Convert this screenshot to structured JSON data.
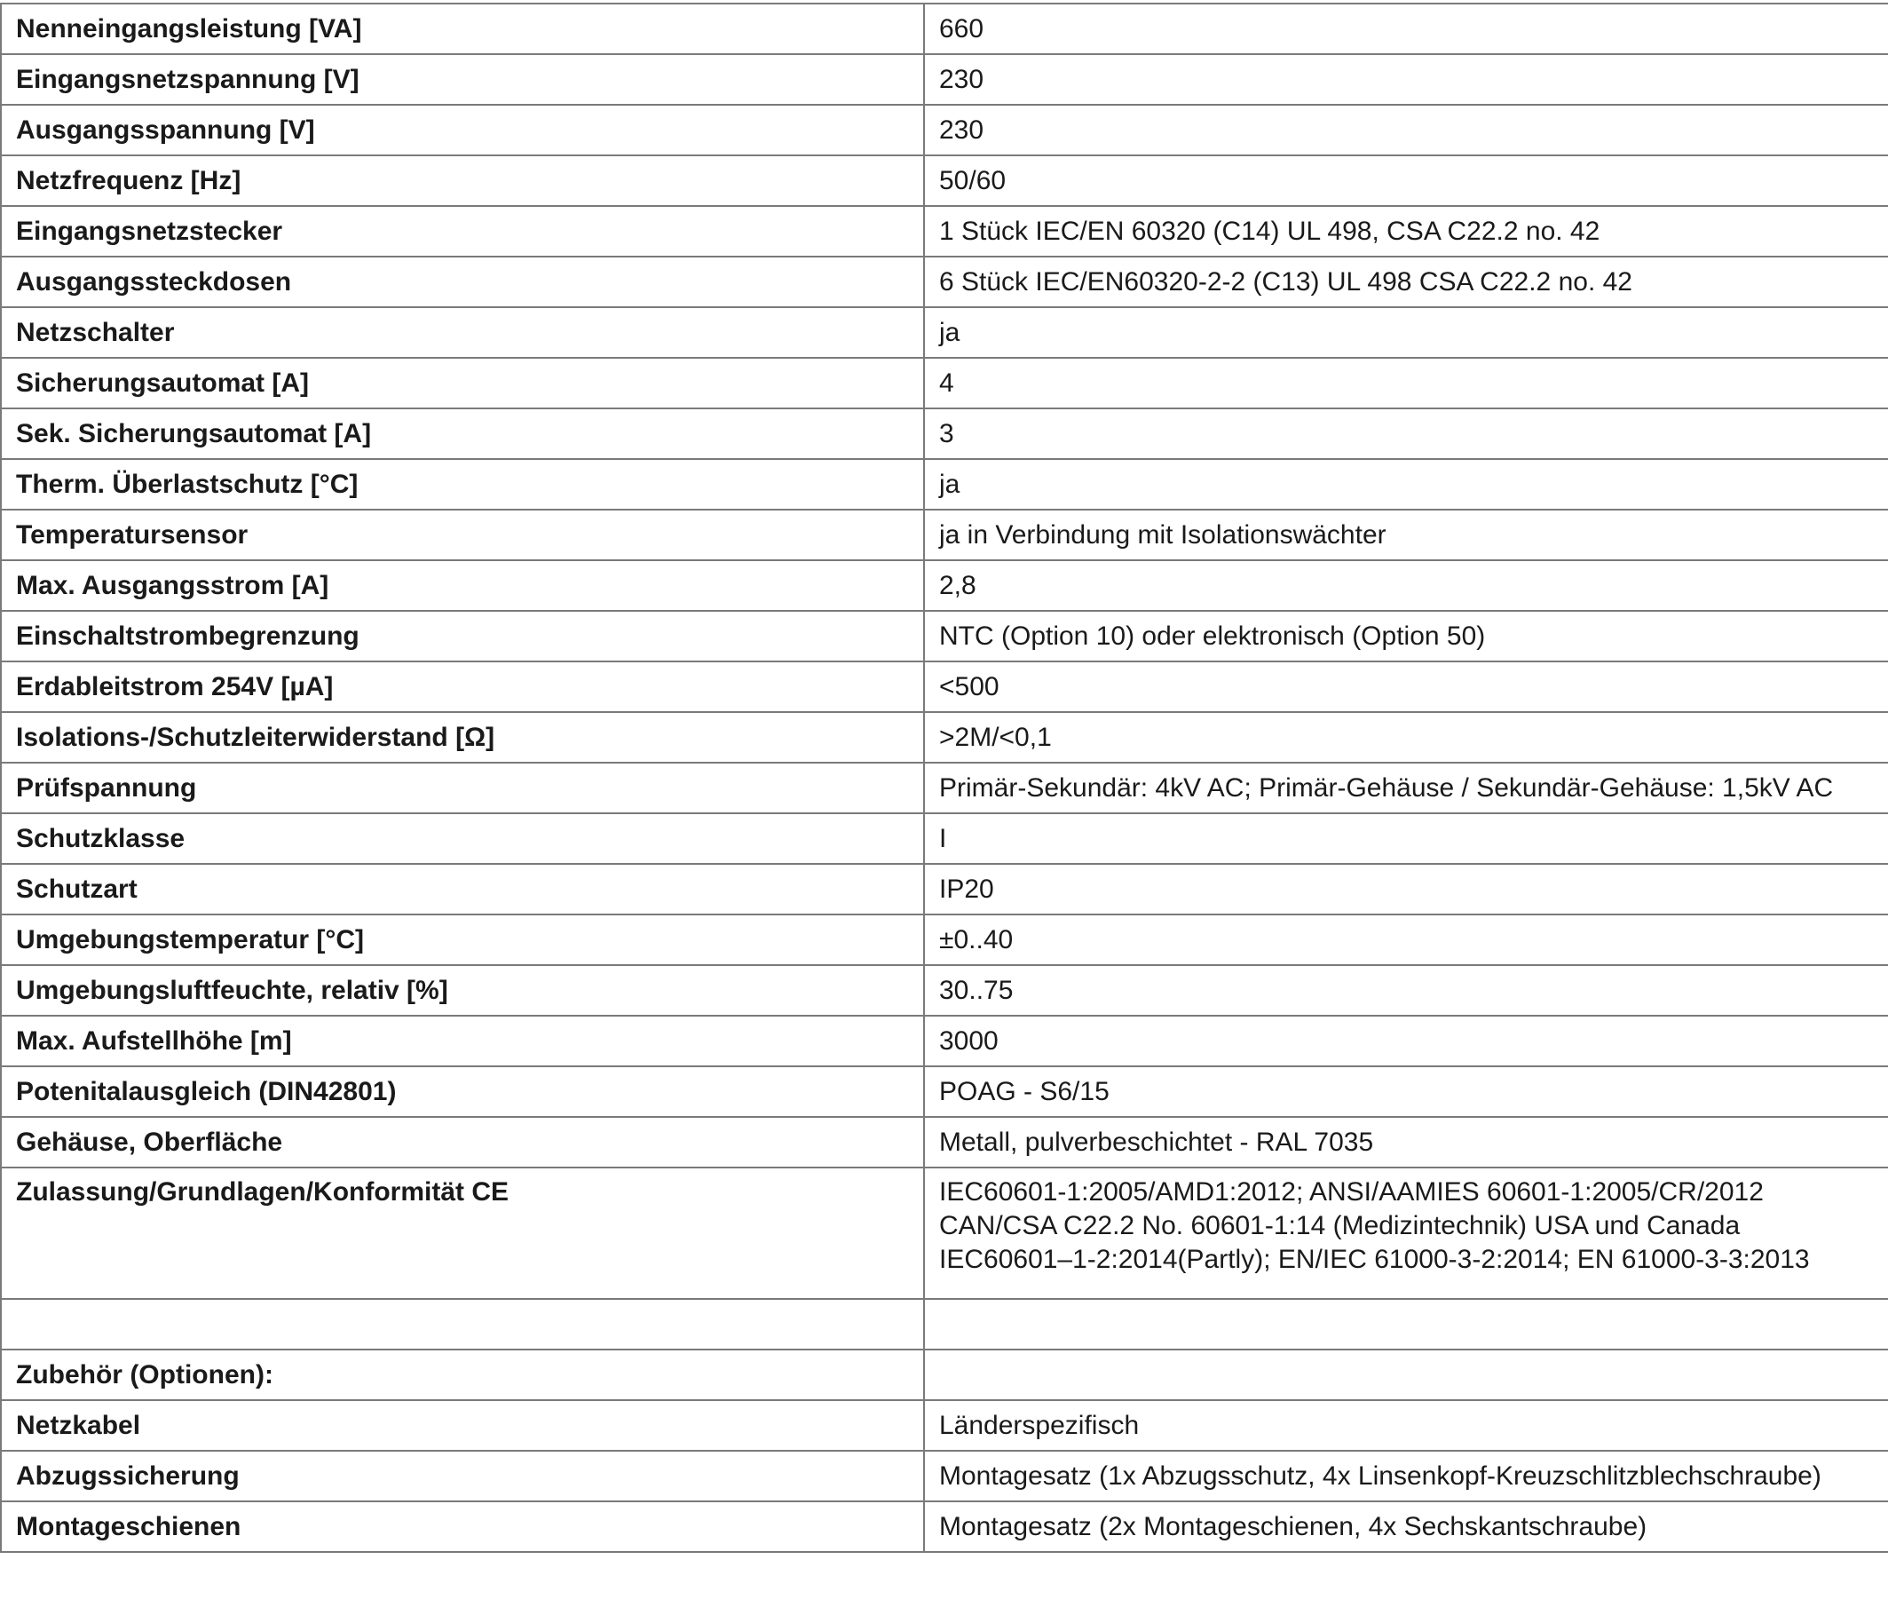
{
  "rows": [
    {
      "label": "Nenneingangsleistung [VA]",
      "value": "660"
    },
    {
      "label": "Eingangsnetzspannung [V]",
      "value": "230"
    },
    {
      "label": "Ausgangsspannung [V]",
      "value": "230"
    },
    {
      "label": "Netzfrequenz [Hz]",
      "value": "50/60"
    },
    {
      "label": "Eingangsnetzstecker",
      "value": "1 Stück IEC/EN 60320 (C14) UL 498, CSA C22.2 no. 42"
    },
    {
      "label": "Ausgangssteckdosen",
      "value": "6 Stück IEC/EN60320-2-2 (C13) UL 498 CSA C22.2 no. 42"
    },
    {
      "label": "Netzschalter",
      "value": "ja"
    },
    {
      "label": "Sicherungsautomat [A]",
      "value": "4"
    },
    {
      "label": "Sek. Sicherungsautomat [A]",
      "value": "3"
    },
    {
      "label": "Therm. Überlastschutz [°C]",
      "value": "ja"
    },
    {
      "label": "Temperatursensor",
      "value": "ja in Verbindung mit Isolationswächter"
    },
    {
      "label": "Max. Ausgangsstrom [A]",
      "value": "2,8"
    },
    {
      "label": "Einschaltstrombegrenzung",
      "value": "NTC (Option 10) oder elektronisch (Option 50)"
    },
    {
      "label": "Erdableitstrom 254V [µA]",
      "value": "<500"
    },
    {
      "label": "Isolations-/Schutzleiterwiderstand [Ω]",
      "value": ">2M/<0,1"
    },
    {
      "label": "Prüfspannung",
      "value": "Primär-Sekundär: 4kV AC; Primär-Gehäuse / Sekundär-Gehäuse: 1,5kV AC"
    },
    {
      "label": "Schutzklasse",
      "value": "I"
    },
    {
      "label": "Schutzart",
      "value": "IP20"
    },
    {
      "label": "Umgebungstemperatur [°C]",
      "value": "±0..40"
    },
    {
      "label": "Umgebungsluftfeuchte, relativ [%]",
      "value": "30..75"
    },
    {
      "label": "Max. Aufstellhöhe [m]",
      "value": "3000"
    },
    {
      "label": "Potenitalausgleich (DIN42801)",
      "value": "POAG - S6/15"
    },
    {
      "label": "Gehäuse, Oberfläche",
      "value": "Metall, pulverbeschichtet - RAL 7035"
    },
    {
      "label": "Zulassung/Grundlagen/Konformität CE",
      "value": "IEC60601-1:2005/AMD1:2012; ANSI/AAMIES 60601-1:2005/CR/2012\nCAN/CSA C22.2 No. 60601-1:14 (Medizintechnik) USA und Canada\nIEC60601–1-2:2014(Partly); EN/IEC 61000-3-2:2014; EN 61000-3-3:2013"
    },
    {
      "label": "",
      "value": ""
    },
    {
      "label": "Zubehör (Optionen):",
      "value": ""
    },
    {
      "label": "Netzkabel",
      "value": "Länderspezifisch"
    },
    {
      "label": "Abzugssicherung",
      "value": "Montagesatz (1x Abzugsschutz, 4x Linsenkopf-Kreuzschlitzblechschraube)"
    },
    {
      "label": "Montageschienen",
      "value": "Montagesatz (2x Montageschienen, 4x Sechskantschraube)"
    }
  ]
}
